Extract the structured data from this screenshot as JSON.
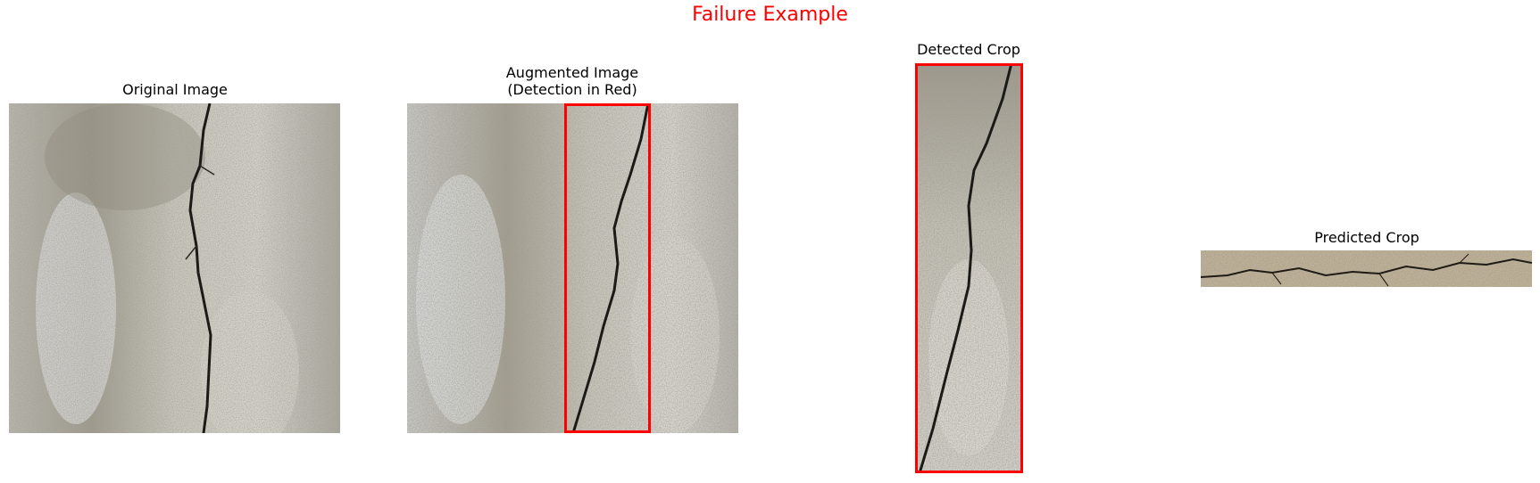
{
  "suptitle": "Failure Example",
  "panels": {
    "original": {
      "title": "Original Image"
    },
    "augmented": {
      "title": "Augmented Image\n(Detection in Red)"
    },
    "detected": {
      "title": "Detected Crop"
    },
    "predicted": {
      "title": "Predicted Crop"
    }
  },
  "colors": {
    "title": "#ff0000",
    "detection_box": "#ff0000"
  }
}
